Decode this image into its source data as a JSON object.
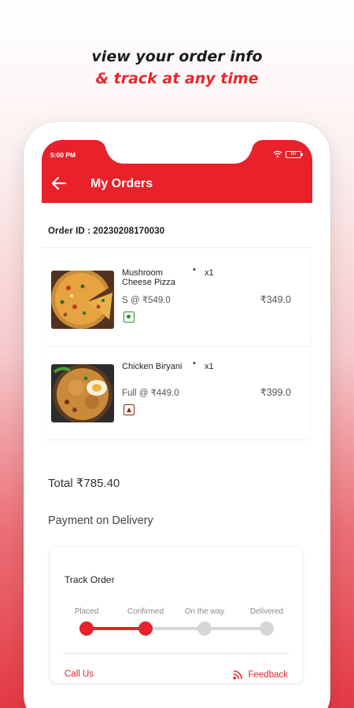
{
  "promo": {
    "line1": "view your order info",
    "line2": "& track at any time"
  },
  "status_bar": {
    "time": "5:00 PM",
    "battery_level": "80"
  },
  "app_bar": {
    "title": "My Orders",
    "back_icon": "arrow-left-icon"
  },
  "order": {
    "id_label": "Order ID : 20230208170030",
    "items": [
      {
        "name": "Mushroom Cheese Pizza",
        "qty": "x1",
        "size_price": "S @ ₹549.0",
        "price": "₹349.0",
        "diet": "veg"
      },
      {
        "name": "Chicken Biryani",
        "qty": "x1",
        "size_price": "Full @ ₹449.0",
        "price": "₹399.0",
        "diet": "non-veg"
      }
    ],
    "total": "Total ₹785.40",
    "payment": "Payment on Delivery"
  },
  "track": {
    "title": "Track Order",
    "steps": [
      {
        "label": "Placed",
        "done": true
      },
      {
        "label": "Confirmed",
        "done": true
      },
      {
        "label": "On the way",
        "done": false
      },
      {
        "label": "Delivered",
        "done": false
      }
    ],
    "call_label": "Call Us",
    "feedback_label": "Feedback"
  },
  "colors": {
    "accent": "#e8212b",
    "veg": "#2e8b2e",
    "non_veg": "#8a2a1a",
    "inactive": "#d6d6d6"
  }
}
